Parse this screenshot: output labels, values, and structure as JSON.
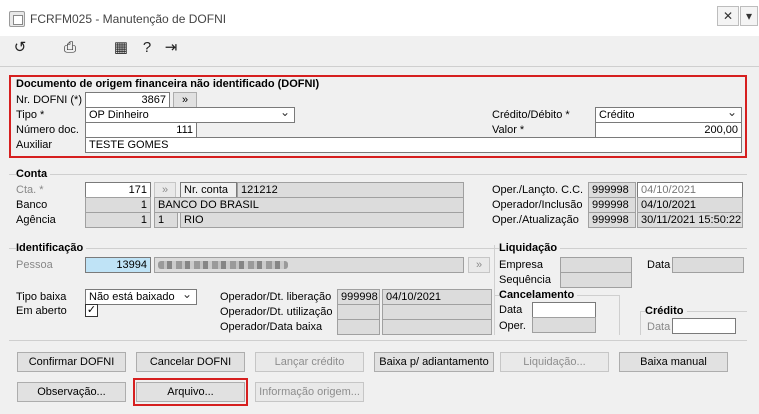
{
  "window": {
    "title": "FCRFM025 - Manutenção de DOFNI"
  },
  "toolbar": {
    "icons": [
      "undo-icon",
      "print-icon",
      "calendar-icon",
      "help-icon",
      "exit-icon"
    ]
  },
  "dofni": {
    "group_title": "Documento de origem financeira não identificado (DOFNI)",
    "nr_label": "Nr. DOFNI (*)",
    "nr_value": "3867",
    "nr_button": "»",
    "tipo_label": "Tipo *",
    "tipo_value": "OP Dinheiro",
    "credito_debito_label": "Crédito/Débito *",
    "credito_debito_value": "Crédito",
    "numero_label": "Número doc.",
    "numero_value": "111",
    "valor_label": "Valor *",
    "valor_value": "200,00",
    "auxiliar_label": "Auxiliar",
    "auxiliar_value": "TESTE GOMES"
  },
  "conta": {
    "group_title": "Conta",
    "cta_label": "Cta. *",
    "cta_value": "171",
    "cta_button": "»",
    "nrconta_label": "Nr. conta",
    "nrconta_value": "121212",
    "banco_label": "Banco",
    "banco_code": "1",
    "banco_name": "BANCO DO BRASIL",
    "agencia_label": "Agência",
    "agencia_code": "1",
    "agencia_digit": "1",
    "agencia_name": "RIO",
    "oper_lancto_label": "Oper./Lançto. C.C.",
    "oper_lancto_code": "999998",
    "oper_lancto_date": "04/10/2021",
    "operador_inclusao_label": "Operador/Inclusão",
    "operador_inclusao_code": "999998",
    "operador_inclusao_date": "04/10/2021",
    "oper_atualizacao_label": "Oper./Atualização",
    "oper_atualizacao_code": "999998",
    "oper_atualizacao_date": "30/11/2021 15:50:22"
  },
  "identificacao": {
    "group_title": "Identificação",
    "pessoa_label": "Pessoa",
    "pessoa_value": "13994",
    "pessoa_button": "»",
    "tipo_baixa_label": "Tipo baixa",
    "tipo_baixa_value": "Não está baixado",
    "em_aberto_label": "Em aberto",
    "em_aberto_checked": "✓",
    "op_liberacao_label": "Operador/Dt. liberação",
    "op_liberacao_code": "999998",
    "op_liberacao_date": "04/10/2021",
    "op_utilizacao_label": "Operador/Dt. utilização",
    "op_baixa_label": "Operador/Data baixa"
  },
  "liquidacao": {
    "group_title": "Liquidação",
    "empresa_label": "Empresa",
    "sequencia_label": "Sequência",
    "data_label": "Data"
  },
  "cancelamento": {
    "group_title": "Cancelamento",
    "data_label": "Data",
    "oper_label": "Oper."
  },
  "credito": {
    "group_title": "Crédito",
    "data_label": "Data"
  },
  "buttons": {
    "confirmar": "Confirmar DOFNI",
    "cancelar": "Cancelar DOFNI",
    "lancar": "Lançar crédito",
    "baixa_adiantamento": "Baixa p/ adiantamento",
    "liquidacao": "Liquidação...",
    "baixa_manual": "Baixa manual",
    "observacao": "Observação...",
    "arquivo": "Arquivo...",
    "informacao_origem": "Informação origem..."
  },
  "colors": {
    "highlight_red": "#d61f1f",
    "readonly_gray": "#dcdcdc",
    "pessoa_blue": "#bfe3f6"
  }
}
